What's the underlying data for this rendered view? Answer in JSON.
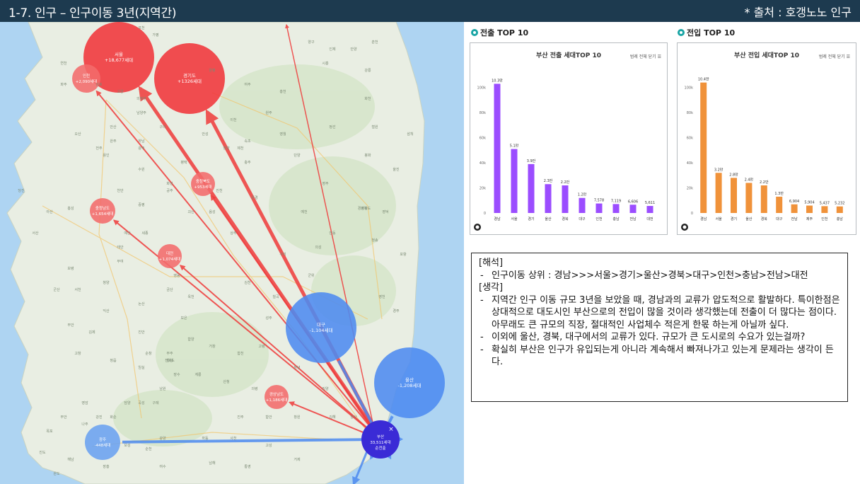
{
  "header": {
    "title": "1-7. 인구 – 인구이동 3년(지역간)",
    "source": "* 출처 : 호갱노노 인구"
  },
  "map": {
    "bubbles": [
      {
        "name": "서울",
        "value": "+18,677세대",
        "color": "#f0363a",
        "type": "inflow"
      },
      {
        "name": "인천",
        "value": "+2,090세대",
        "color": "#f26b6b",
        "type": "inflow"
      },
      {
        "name": "경기도",
        "value": "+1326세대",
        "color": "#f0363a",
        "type": "inflow"
      },
      {
        "name": "충청북도",
        "value": "+953세대",
        "color": "#f26b6b",
        "type": "inflow"
      },
      {
        "name": "충청남도",
        "value": "+1,654세대",
        "color": "#f26b6b",
        "type": "inflow"
      },
      {
        "name": "대전",
        "value": "+1,074세대",
        "color": "#f26b6b",
        "type": "inflow"
      },
      {
        "name": "대구",
        "value": "-1,104세대",
        "color": "#4d8bf0",
        "type": "outflow"
      },
      {
        "name": "울산",
        "value": "-1,208세대",
        "color": "#4d8bf0",
        "type": "outflow"
      },
      {
        "name": "경상남도",
        "value": "+1,186세대",
        "color": "#f26b6b",
        "type": "inflow"
      },
      {
        "name": "광주",
        "value": "-448세대",
        "color": "#6aa2f0",
        "type": "outflow"
      },
      {
        "name": "부산",
        "value": "33,511세대",
        "extra": "순전출",
        "color": "#3a2bd6",
        "type": "center"
      }
    ],
    "place_labels": [
      "경상북도",
      "전북도",
      "홍성",
      "세종",
      "충주",
      "영주",
      "봉화",
      "원주",
      "홍천",
      "안동",
      "구미",
      "김천",
      "상주",
      "문경",
      "영천",
      "경주",
      "포항",
      "청송",
      "영덕",
      "울진",
      "삼척",
      "강릉",
      "정선",
      "영월",
      "제천",
      "단양",
      "예천",
      "의성",
      "군위",
      "칠곡",
      "성주",
      "고령",
      "합천",
      "거창",
      "함양",
      "산청",
      "진주",
      "사천",
      "하동",
      "남해",
      "통영",
      "거제",
      "창원",
      "김해",
      "양산",
      "밀양",
      "창녕",
      "의령",
      "함안",
      "고성",
      "광양",
      "순천",
      "여수",
      "보성",
      "장흥",
      "강진",
      "해남",
      "완도",
      "진도",
      "목포",
      "무안",
      "영암",
      "나주",
      "화순",
      "담양",
      "곡성",
      "구례",
      "남원",
      "임실",
      "순창",
      "정읍",
      "고창",
      "부안",
      "김제",
      "익산",
      "군산",
      "서천",
      "보령",
      "청양",
      "부여",
      "논산",
      "금산",
      "영동",
      "옥천",
      "보은",
      "괴산",
      "음성",
      "진천",
      "증평",
      "천안",
      "아산",
      "당진",
      "서산",
      "태안",
      "예산",
      "공주",
      "계룡",
      "장수",
      "무주",
      "진안",
      "완주",
      "전주",
      "수원",
      "화성",
      "평택",
      "안성",
      "이천",
      "여주",
      "양평",
      "가평",
      "포천",
      "연천",
      "파주",
      "김포",
      "고양",
      "의정부",
      "남양주",
      "구리",
      "하남",
      "광주",
      "용인",
      "오산",
      "안산",
      "시흥",
      "안양",
      "춘천",
      "인제",
      "양구",
      "화천",
      "철원",
      "속초",
      "양양",
      "평창",
      "횡성"
    ]
  },
  "chart_data": [
    {
      "type": "bar",
      "section_label": "전출 TOP 10",
      "title": "부산 전출 세대TOP 10",
      "menu_label": "범례 전체 닫기",
      "categories": [
        "경남",
        "서울",
        "경기",
        "울산",
        "경북",
        "대구",
        "인천",
        "충남",
        "전남",
        "대전"
      ],
      "values": [
        103000,
        51000,
        39000,
        23000,
        22000,
        12000,
        7578,
        7119,
        6606,
        5611
      ],
      "data_labels": [
        "10.3만",
        "5.1만",
        "3.9만",
        "2.3만",
        "2.2만",
        "1.2만",
        "7,578",
        "7,119",
        "6,606",
        "5,611"
      ],
      "y_ticks": [
        "0",
        "20k",
        "40k",
        "60k",
        "80k",
        "100k"
      ],
      "ylim": [
        0,
        110000
      ],
      "color": "#9b4dff"
    },
    {
      "type": "bar",
      "section_label": "전입 TOP 10",
      "title": "부산 전입 세대TOP 10",
      "menu_label": "범례 전체 닫기",
      "categories": [
        "경남",
        "서울",
        "경기",
        "울산",
        "경북",
        "대구",
        "전남",
        "제주",
        "인천",
        "충남"
      ],
      "values": [
        104000,
        32000,
        28000,
        24000,
        22000,
        13000,
        6904,
        5904,
        5437,
        5232
      ],
      "data_labels": [
        "10.4만",
        "3.2만",
        "2.8만",
        "2.4만",
        "2.2만",
        "1.3만",
        "6,904",
        "5,904",
        "5,437",
        "5,232"
      ],
      "y_ticks": [
        "0",
        "20k",
        "40k",
        "60k",
        "80k",
        "100k"
      ],
      "ylim": [
        0,
        110000
      ],
      "color": "#f0923a"
    }
  ],
  "analysis": {
    "interpret_head": "[해석]",
    "interpret_items": [
      "인구이동 상위 : 경남>>>서울>경기>울산>경북>대구>인천>충남>전남>대전"
    ],
    "thought_head": "[생각]",
    "thought_items": [
      "지역간 인구 이동 규모 3년을 보았을 때, 경남과의 교류가 압도적으로 활발하다. 특이한점은 상대적으로 대도시인 부산으로의 전입이 많을 것이라 생각했는데 전출이 더 많다는 점이다. 아무래도 큰 규모의 직장, 절대적인 사업체수 적은게 한몫 하는게 아닐까 싶다.",
      "이외에 울산, 경북, 대구에서의 교류가 있다. 규모가 큰 도시로의 수요가 있는걸까?",
      "확실히 부산은 인구가 유입되는게 아니라 계속해서 빠져나가고 있는게 문제라는 생각이 든다."
    ]
  }
}
